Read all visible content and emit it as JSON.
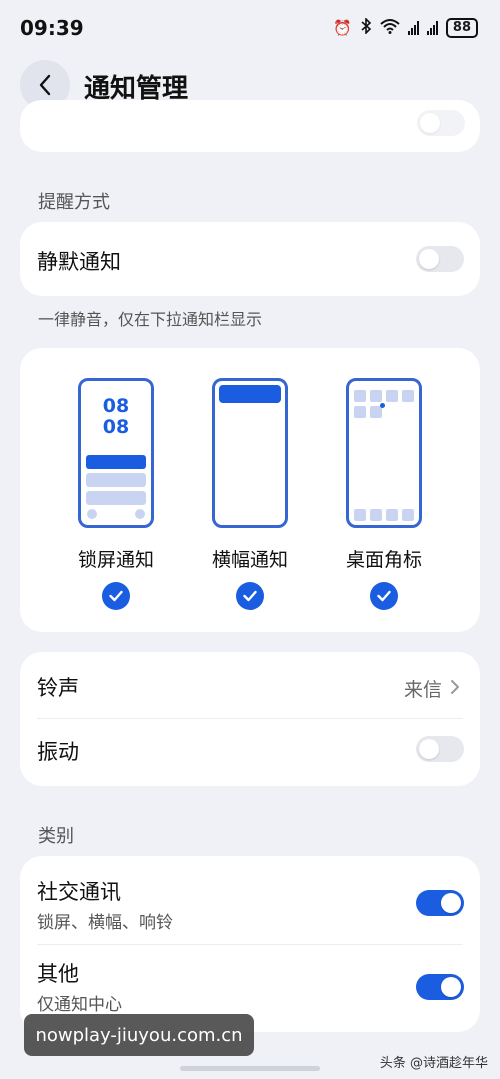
{
  "status_bar": {
    "time": "09:39",
    "battery": "88",
    "icons": [
      "alarm-icon",
      "bluetooth-icon",
      "wifi-icon",
      "signal-icon",
      "signal-icon",
      "battery-icon"
    ]
  },
  "header": {
    "title": "通知管理",
    "back_icon": "chevron-left-icon"
  },
  "sections": {
    "reminder_label": "提醒方式",
    "category_label": "类别"
  },
  "silent": {
    "label": "静默通知",
    "enabled": false,
    "caption": "一律静音，仅在下拉通知栏显示"
  },
  "styles": {
    "preview_time_top": "08",
    "preview_time_bottom": "08",
    "options": [
      {
        "label": "锁屏通知",
        "checked": true
      },
      {
        "label": "横幅通知",
        "checked": true
      },
      {
        "label": "桌面角标",
        "checked": true
      }
    ]
  },
  "sound": {
    "ringtone_label": "铃声",
    "ringtone_value": "来信",
    "vibrate_label": "振动",
    "vibrate_enabled": false
  },
  "categories": [
    {
      "title": "社交通讯",
      "subtitle": "锁屏、横幅、响铃",
      "enabled": true
    },
    {
      "title": "其他",
      "subtitle": "仅通知中心",
      "enabled": true
    }
  ],
  "overlay": {
    "watermark": "nowplay-jiuyou.com.cn",
    "credit": "头条 @诗酒趁年华"
  },
  "colors": {
    "accent": "#1a5de0",
    "page_bg": "#eff1f6",
    "card_bg": "#ffffff"
  }
}
